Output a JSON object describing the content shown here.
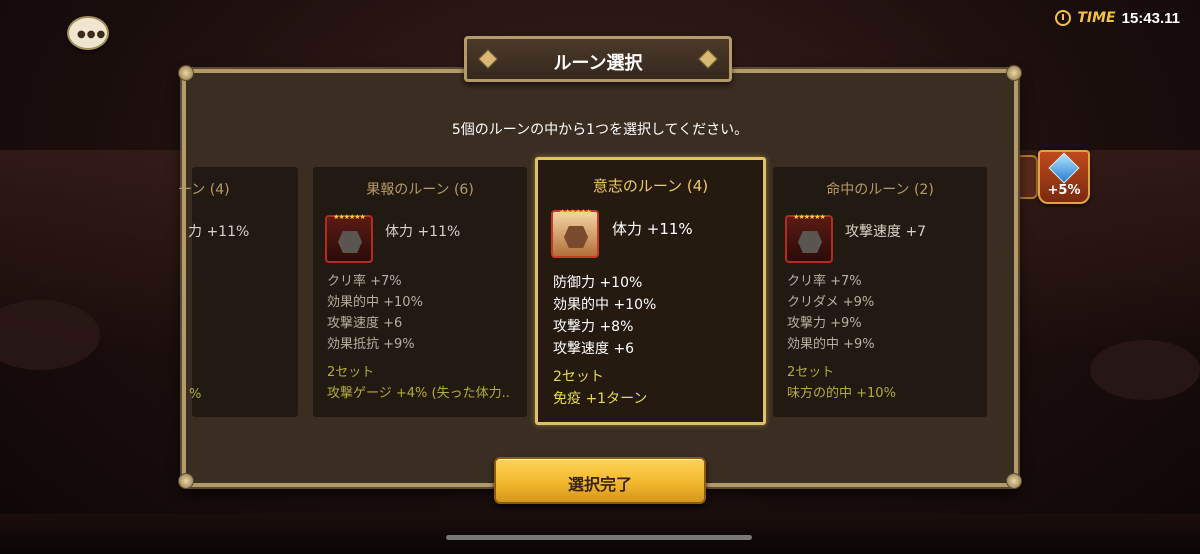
{
  "status": {
    "time_label": "TIME",
    "time_value": "15:43.11"
  },
  "dialog": {
    "title": "ルーン選択",
    "instruction": "5個のルーンの中から1つを選択してください。",
    "confirm_label": "選択完了"
  },
  "side_icon": {
    "label": "+5%"
  },
  "cards": [
    {
      "name": "ーン (4)",
      "main_stat": "力 +11%",
      "set_text": "%"
    },
    {
      "name": "果報のルーン (6)",
      "main_stat": "体力 +11%",
      "sub_stats": [
        "クリ率 +7%",
        "効果的中 +10%",
        "攻撃速度 +6",
        "効果抵抗 +9%"
      ],
      "set_label": "2セット",
      "set_effect": "攻撃ゲージ +4% (失った体力..",
      "stars": "★★★★★★"
    },
    {
      "name": "意志のルーン (4)",
      "main_stat": "体力 +11%",
      "sub_stats": [
        "防御力 +10%",
        "効果的中 +10%",
        "攻撃力 +8%",
        "攻撃速度 +6"
      ],
      "set_label": "2セット",
      "set_effect": "免疫 +1ターン",
      "stars": "★★★★★★"
    },
    {
      "name": "命中のルーン (2)",
      "main_stat": "攻撃速度 +7",
      "sub_stats": [
        "クリ率 +7%",
        "クリダメ +9%",
        "攻撃力 +9%",
        "効果的中 +9%"
      ],
      "set_label": "2セット",
      "set_effect": "味方の的中 +10%",
      "stars": "★★★★★★"
    }
  ],
  "colors": {
    "accent_gold": "#e2c064",
    "panel_border": "#b49a68",
    "set_text": "#b5ab34"
  }
}
